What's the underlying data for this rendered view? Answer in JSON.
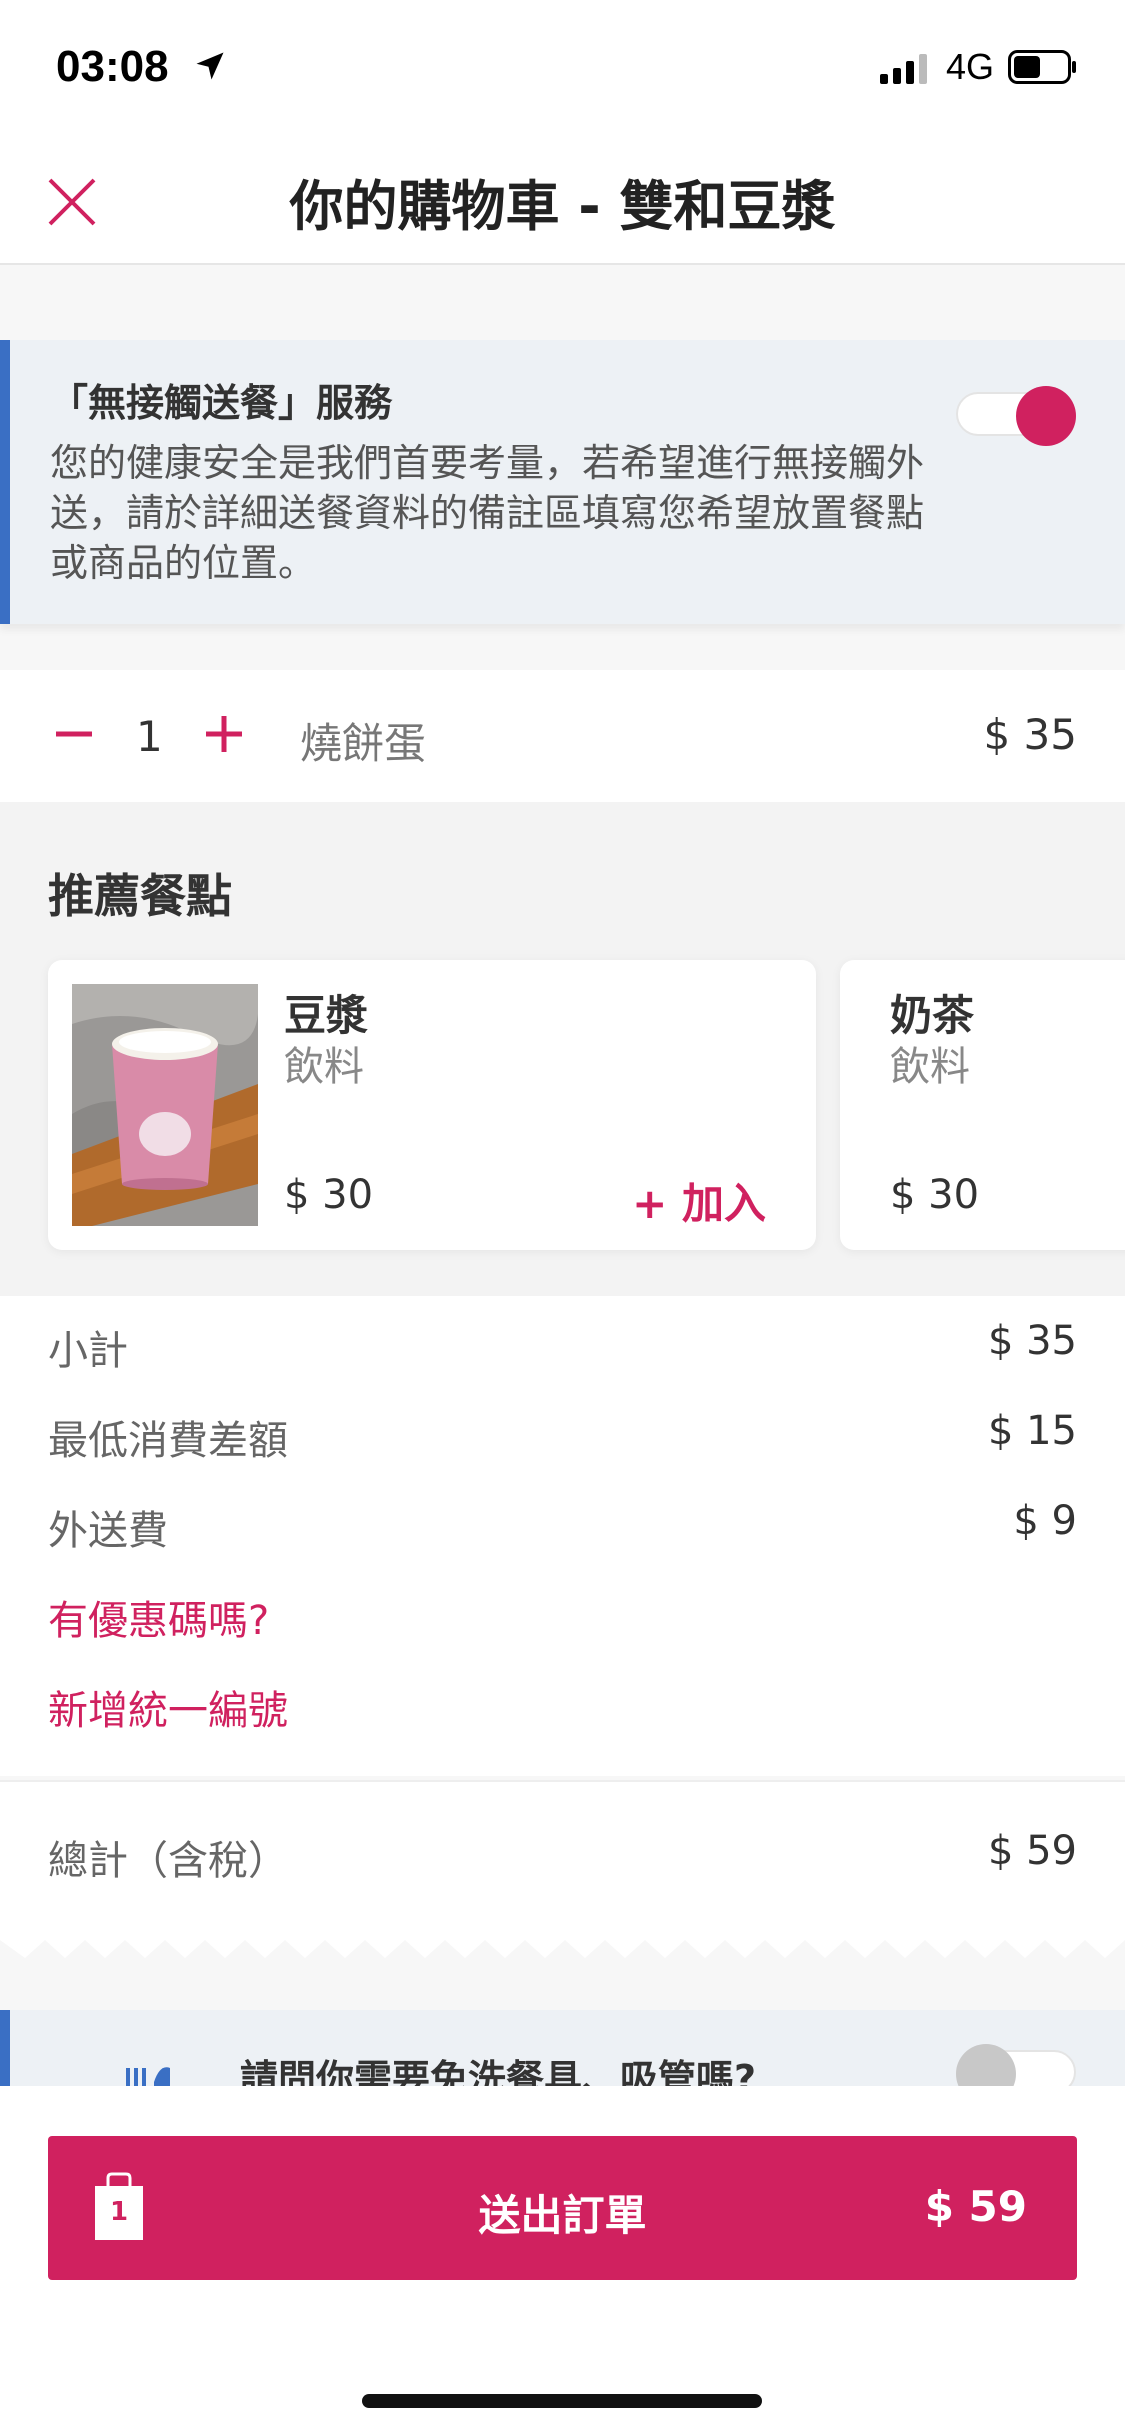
{
  "status_bar": {
    "time": "03:08",
    "network": "4G"
  },
  "header": {
    "title": "你的購物車 - 雙和豆漿"
  },
  "contactless": {
    "title": "「無接觸送餐」服務",
    "body": "您的健康安全是我們首要考量，若希望進行無接觸外送，請於詳細送餐資料的備註區填寫您希望放置餐點或商品的位置。",
    "enabled": true
  },
  "cart_item": {
    "quantity": "1",
    "name": "燒餅蛋",
    "price": "$ 35"
  },
  "recommendations": {
    "title": "推薦餐點",
    "items": [
      {
        "name": "豆漿",
        "category": "飲料",
        "price": "$ 30",
        "add_label": "+ 加入"
      },
      {
        "name": "奶茶",
        "category": "飲料",
        "price": "$ 30"
      }
    ]
  },
  "summary": {
    "subtotal_label": "小計",
    "subtotal": "$ 35",
    "min_diff_label": "最低消費差額",
    "min_diff": "$ 15",
    "delivery_label": "外送費",
    "delivery": "$ 9",
    "promo_link": "有優惠碼嗎?",
    "tax_id_link": "新增統一編號"
  },
  "total": {
    "label": "總計（含稅）",
    "value": "$ 59"
  },
  "cutlery": {
    "text": "請問你需要免洗餐具、吸管嗎?",
    "enabled": false
  },
  "submit": {
    "label": "送出訂單",
    "price": "$ 59",
    "cart_count": "1"
  },
  "colors": {
    "accent": "#d0215f",
    "banner_border": "#3a6fc4",
    "banner_bg": "#edf1f5"
  },
  "icons": [
    "location-arrow-icon",
    "signal-icon",
    "battery-icon",
    "close-icon",
    "minus-icon",
    "plus-icon",
    "cutlery-icon",
    "shopping-bag-icon"
  ]
}
